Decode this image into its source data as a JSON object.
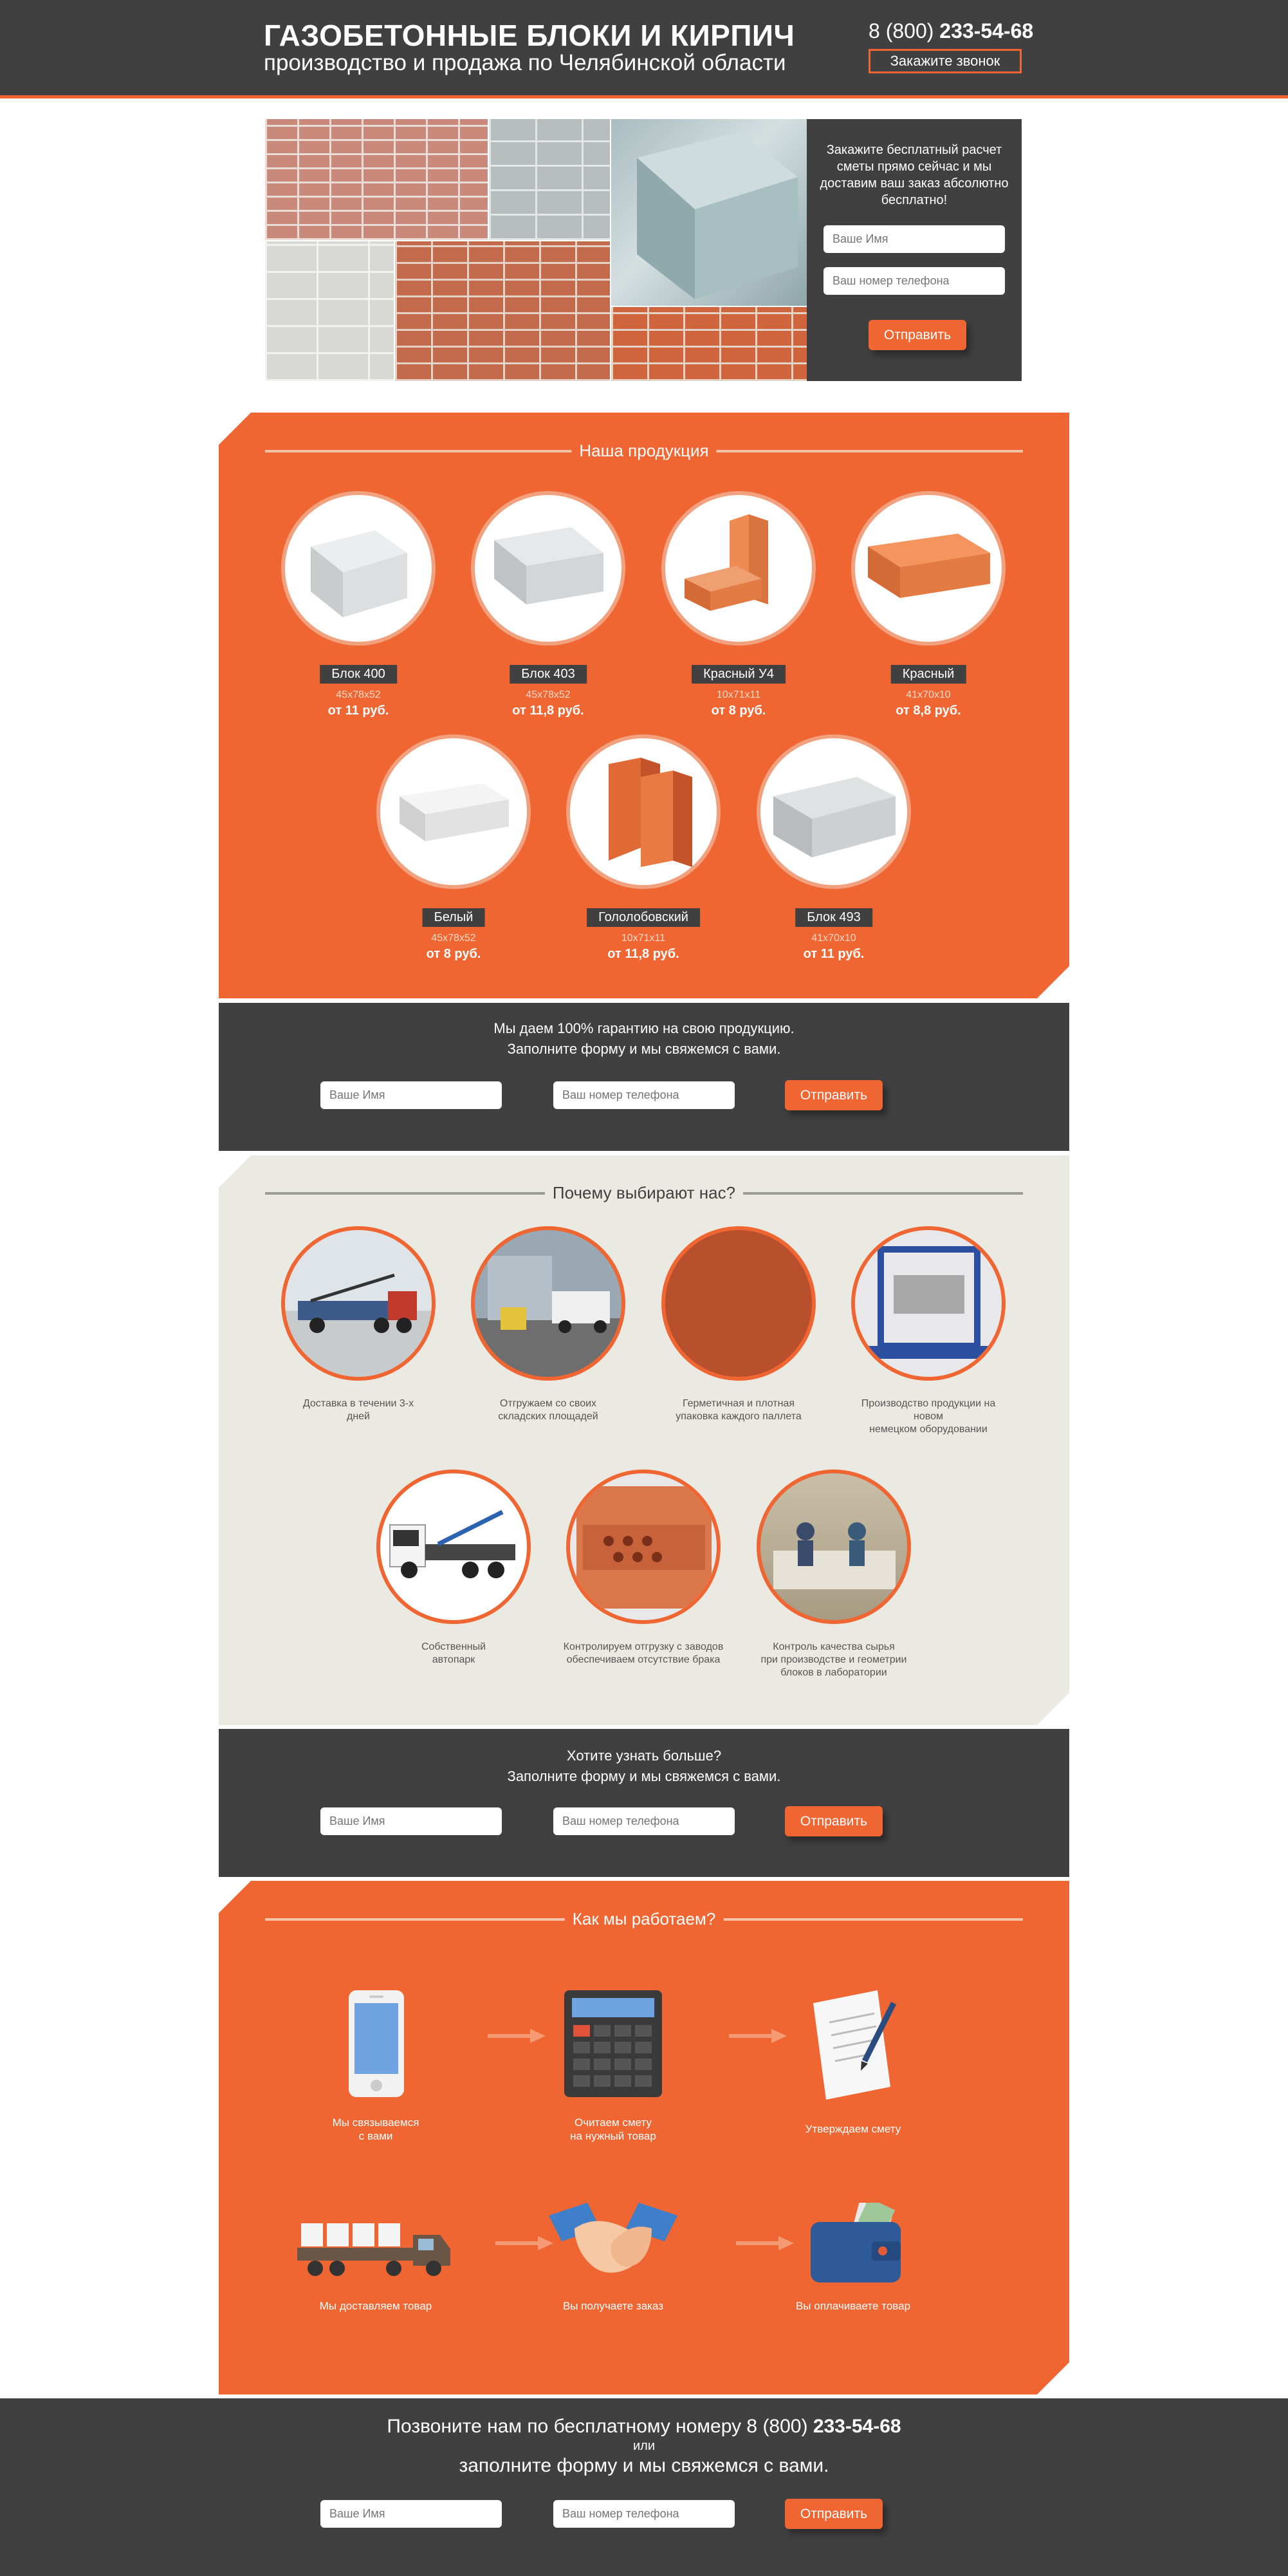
{
  "header": {
    "title": "ГАЗОБЕТОННЫЕ БЛОКИ И КИРПИЧ",
    "subtitle": "производство и продажа по Челябинской области",
    "phone_prefix": "8 (800) ",
    "phone_number": "233-54-68",
    "callback_button": "Закажите звонок"
  },
  "hero_form": {
    "text": "Закажите бесплатный расчет сметы прямо сейчас и мы доставим ваш заказ абсолютно бесплатно!",
    "name_placeholder": "Ваше Имя",
    "phone_placeholder": "Ваш номер телефона",
    "submit": "Отправить"
  },
  "products": {
    "heading": "Наша продукция",
    "items": [
      {
        "name": "Блок 400",
        "size": "45x78x52",
        "price": "от 11 руб."
      },
      {
        "name": "Блок 403",
        "size": "45x78x52",
        "price": "от 11,8 руб."
      },
      {
        "name": "Красный У4",
        "size": "10x71x11",
        "price": "от 8 руб."
      },
      {
        "name": "Красный",
        "size": "41x70x10",
        "price": "от 8,8 руб."
      },
      {
        "name": "Белый",
        "size": "45x78x52",
        "price": "от 8 руб."
      },
      {
        "name": "Гололобовский",
        "size": "10x71x11",
        "price": "от 11,8 руб."
      },
      {
        "name": "Блок 493",
        "size": "41x70x10",
        "price": "от 11 руб."
      }
    ]
  },
  "form1": {
    "line1": "Мы даем 100% гарантию на свою продукцию.",
    "line2": "Заполните форму и мы свяжемся с вами.",
    "name_placeholder": "Ваше Имя",
    "phone_placeholder": "Ваш номер телефона",
    "submit": "Отправить"
  },
  "why": {
    "heading": "Почему выбирают нас?",
    "items": [
      {
        "line1": "Доставка в течении 3-х",
        "line2": "дней",
        "line3": ""
      },
      {
        "line1": "Отгружаем со своих",
        "line2": "складских площадей",
        "line3": ""
      },
      {
        "line1": "Герметичная и плотная",
        "line2": "упаковка каждого паллета",
        "line3": ""
      },
      {
        "line1": "Производство продукции на новом",
        "line2": "немецком оборудовании",
        "line3": ""
      },
      {
        "line1": "Собственный",
        "line2": "автопарк",
        "line3": ""
      },
      {
        "line1": "Контролируем отгрузку с заводов",
        "line2": "обеспечиваем отсутствие брака",
        "line3": ""
      },
      {
        "line1": "Контроль качества сырья",
        "line2": "при производстве и геометрии",
        "line3": "блоков в лаборатории"
      }
    ]
  },
  "form2": {
    "line1": "Хотите узнать больше?",
    "line2": "Заполните форму и мы свяжемся с вами.",
    "name_placeholder": "Ваше Имя",
    "phone_placeholder": "Ваш номер телефона",
    "submit": "Отправить"
  },
  "how": {
    "heading": "Как мы работаем?",
    "steps": [
      {
        "line1": "Мы связываемся",
        "line2": "с вами"
      },
      {
        "line1": "Очитаем смету",
        "line2": "на нужный товар"
      },
      {
        "line1": "Утверждаем смету",
        "line2": ""
      },
      {
        "line1": "Мы доставляем товар",
        "line2": ""
      },
      {
        "line1": "Вы получаете заказ",
        "line2": ""
      },
      {
        "line1": "Вы оплачиваете товар",
        "line2": ""
      }
    ]
  },
  "footer": {
    "line1_prefix": "Позвоните нам  по бесплатному номеру 8 (800) ",
    "line1_number": "233-54-68",
    "line2": "или",
    "line3": "заполните форму и мы свяжемся с вами.",
    "name_placeholder": "Ваше Имя",
    "phone_placeholder": "Ваш номер телефона",
    "submit": "Отправить"
  },
  "colors": {
    "accent": "#ef6633",
    "dark": "#404040",
    "beige": "#ebeae2"
  }
}
